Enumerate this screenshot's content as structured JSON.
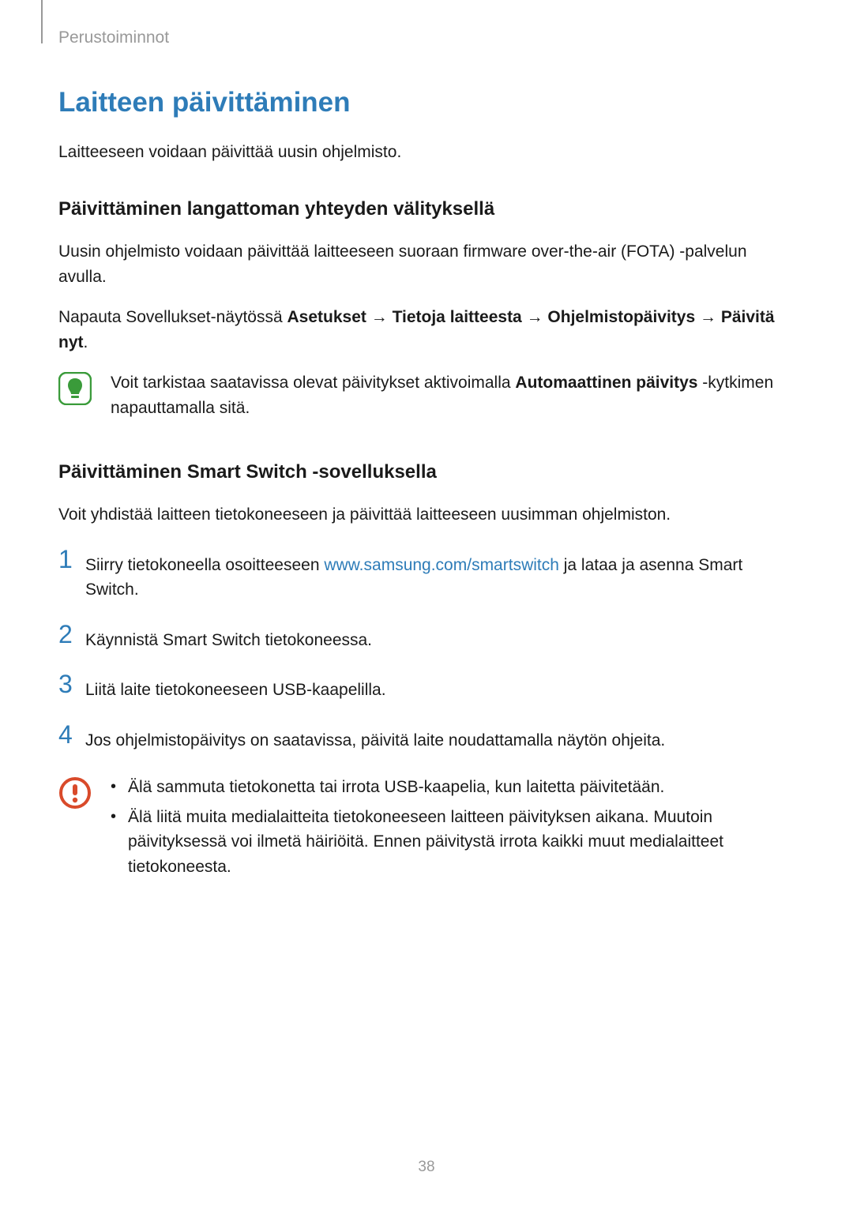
{
  "header": "Perustoiminnot",
  "title": "Laitteen päivittäminen",
  "intro": "Laitteeseen voidaan päivittää uusin ohjelmisto.",
  "section1": {
    "heading": "Päivittäminen langattoman yhteyden välityksellä",
    "para1": "Uusin ohjelmisto voidaan päivittää laitteeseen suoraan firmware over-the-air (FOTA) -palvelun avulla.",
    "nav_prefix": "Napauta Sovellukset-näytössä ",
    "nav_b1": "Asetukset",
    "nav_arrow": " → ",
    "nav_b2": "Tietoja laitteesta",
    "nav_b3": "Ohjelmistopäivitys",
    "nav_b4": "Päivitä nyt",
    "note_prefix": "Voit tarkistaa saatavissa olevat päivitykset aktivoimalla ",
    "note_bold": "Automaattinen päivitys",
    "note_suffix": " -kytkimen napauttamalla sitä."
  },
  "section2": {
    "heading": "Päivittäminen Smart Switch -sovelluksella",
    "para1": "Voit yhdistää laitteen tietokoneeseen ja päivittää laitteeseen uusimman ohjelmiston.",
    "steps": [
      {
        "num": "1",
        "prefix": "Siirry tietokoneella osoitteeseen ",
        "link": "www.samsung.com/smartswitch",
        "suffix": " ja lataa ja asenna Smart Switch."
      },
      {
        "num": "2",
        "text": "Käynnistä Smart Switch tietokoneessa."
      },
      {
        "num": "3",
        "text": "Liitä laite tietokoneeseen USB-kaapelilla."
      },
      {
        "num": "4",
        "text": "Jos ohjelmistopäivitys on saatavissa, päivitä laite noudattamalla näytön ohjeita."
      }
    ],
    "warnings": [
      "Älä sammuta tietokonetta tai irrota USB-kaapelia, kun laitetta päivitetään.",
      "Älä liitä muita medialaitteita tietokoneeseen laitteen päivityksen aikana. Muutoin päivityksessä voi ilmetä häiriöitä. Ennen päivitystä irrota kaikki muut medialaitteet tietokoneesta."
    ]
  },
  "page_number": "38"
}
